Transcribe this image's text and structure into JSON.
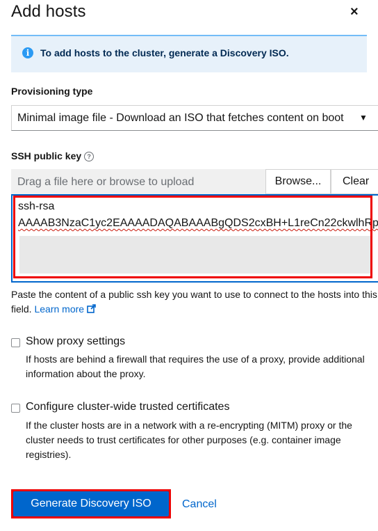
{
  "modal": {
    "title": "Add hosts",
    "close_glyph": "×"
  },
  "alert": {
    "icon": "info-icon",
    "icon_glyph": "i",
    "text": "To add hosts to the cluster, generate a Discovery ISO."
  },
  "provisioning": {
    "label": "Provisioning type",
    "selected": "Minimal image file - Download an ISO that fetches content on boot"
  },
  "ssh": {
    "label": "SSH public key",
    "help_glyph": "?",
    "upload_placeholder": "Drag a file here or browse to upload",
    "browse_label": "Browse...",
    "clear_label": "Clear",
    "key_line1": "ssh-rsa",
    "key_line2": "AAAAB3NzaC1yc2EAAAADAQABAAABgQDS2cxBH+L1reCn22ckwlhRp",
    "helper_text": "Paste the content of a public ssh key you want to use to connect to the hosts into this field.",
    "learn_more": "Learn more"
  },
  "proxy": {
    "label": "Show proxy settings",
    "description": "If hosts are behind a firewall that requires the use of a proxy, provide additional information about the proxy.",
    "checked": false
  },
  "certs": {
    "label": "Configure cluster-wide trusted certificates",
    "description": "If the cluster hosts are in a network with a re-encrypting (MITM) proxy or the cluster needs to trust certificates for other purposes (e.g. container image registries).",
    "checked": false
  },
  "footer": {
    "generate_label": "Generate Discovery ISO",
    "cancel_label": "Cancel"
  },
  "colors": {
    "primary": "#0066cc",
    "highlight": "#ee0000",
    "alert_bg": "#e7f1fa"
  }
}
